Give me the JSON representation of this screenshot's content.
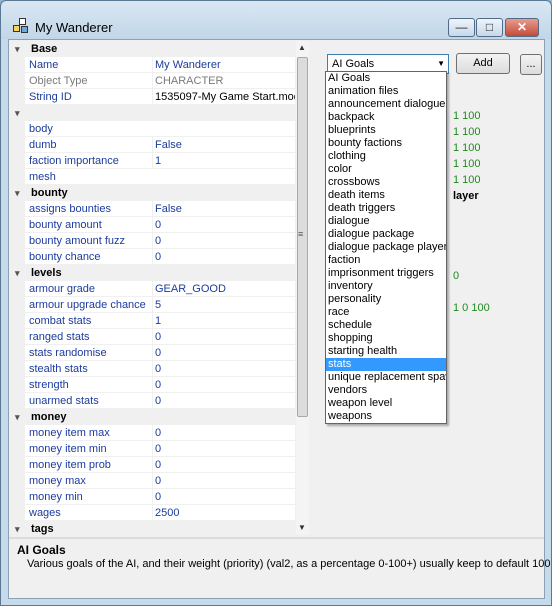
{
  "window": {
    "title": "My Wanderer"
  },
  "grid": {
    "sections": [
      {
        "title": "Base",
        "rows": [
          {
            "name": "Name",
            "value": "My Wanderer"
          },
          {
            "name": "Object Type",
            "value": "CHARACTER",
            "readonly": true
          },
          {
            "name": "String ID",
            "value": "1535097-My Game Start.mod",
            "plain": true
          }
        ]
      },
      {
        "title": "",
        "rows": [
          {
            "name": "body",
            "value": ""
          },
          {
            "name": "dumb",
            "value": "False"
          },
          {
            "name": "faction importance",
            "value": "1"
          },
          {
            "name": "mesh",
            "value": ""
          }
        ]
      },
      {
        "title": "bounty",
        "rows": [
          {
            "name": "assigns bounties",
            "value": "False"
          },
          {
            "name": "bounty amount",
            "value": "0"
          },
          {
            "name": "bounty amount fuzz",
            "value": "0"
          },
          {
            "name": "bounty chance",
            "value": "0"
          }
        ]
      },
      {
        "title": "levels",
        "rows": [
          {
            "name": "armour grade",
            "value": "GEAR_GOOD"
          },
          {
            "name": "armour upgrade chance",
            "value": "5"
          },
          {
            "name": "combat stats",
            "value": "1"
          },
          {
            "name": "ranged stats",
            "value": "0"
          },
          {
            "name": "stats randomise",
            "value": "0"
          },
          {
            "name": "stealth stats",
            "value": "0"
          },
          {
            "name": "strength",
            "value": "0"
          },
          {
            "name": "unarmed stats",
            "value": "0"
          }
        ]
      },
      {
        "title": "money",
        "rows": [
          {
            "name": "money item max",
            "value": "0"
          },
          {
            "name": "money item min",
            "value": "0"
          },
          {
            "name": "money item prob",
            "value": "0"
          },
          {
            "name": "money max",
            "value": "0"
          },
          {
            "name": "money min",
            "value": "0"
          },
          {
            "name": "wages",
            "value": "2500"
          }
        ]
      },
      {
        "title": "tags",
        "rows": []
      }
    ]
  },
  "right": {
    "combo_value": "AI Goals",
    "add_label": "Add",
    "more_label": "...",
    "bg_lines": [
      {
        "text": "1    100"
      },
      {
        "text": "1    100"
      },
      {
        "text": "1    100"
      },
      {
        "text": "1    100"
      },
      {
        "text": "1    100"
      }
    ],
    "bg_heading": "layer",
    "bg_single": "0",
    "bg_triple": "1    0    100"
  },
  "dropdown": {
    "items": [
      "AI Goals",
      "animation files",
      "announcement dialogue",
      "backpack",
      "blueprints",
      "bounty factions",
      "clothing",
      "color",
      "crossbows",
      "death items",
      "death triggers",
      "dialogue",
      "dialogue package",
      "dialogue package player",
      "faction",
      "imprisonment triggers",
      "inventory",
      "personality",
      "race",
      "schedule",
      "shopping",
      "starting health",
      "stats",
      "unique replacement spawn",
      "vendors",
      "weapon level",
      "weapons"
    ],
    "selected_index": 22
  },
  "help": {
    "title": "AI Goals",
    "text": "Various goals of the AI, and their weight (priority) (val2, as a percentage 0-100+) usually keep to default 100"
  }
}
